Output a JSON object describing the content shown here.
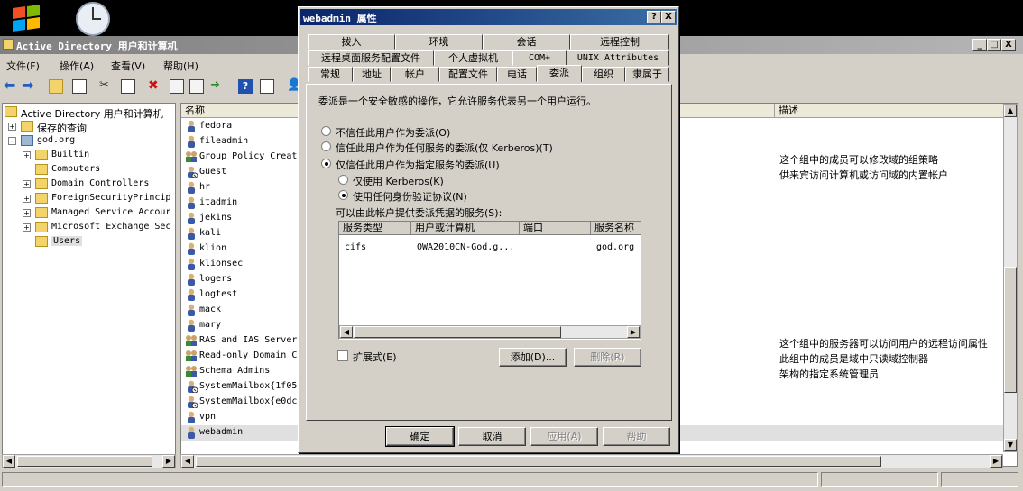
{
  "main_window": {
    "title": "Active Directory 用户和计算机",
    "menu": [
      "文件(F)",
      "操作(A)",
      "查看(V)",
      "帮助(H)"
    ]
  },
  "tree": {
    "items": [
      {
        "label": "Active Directory 用户和计算机",
        "level": 0,
        "expander": ""
      },
      {
        "label": "保存的查询",
        "level": 1,
        "expander": "+"
      },
      {
        "label": "god.org",
        "level": 1,
        "expander": "-"
      },
      {
        "label": "Builtin",
        "level": 2,
        "expander": "+"
      },
      {
        "label": "Computers",
        "level": 2,
        "expander": ""
      },
      {
        "label": "Domain Controllers",
        "level": 2,
        "expander": "+"
      },
      {
        "label": "ForeignSecurityPrincip",
        "level": 2,
        "expander": "+"
      },
      {
        "label": "Managed Service Accour",
        "level": 2,
        "expander": "+"
      },
      {
        "label": "Microsoft Exchange Sec",
        "level": 2,
        "expander": "+"
      },
      {
        "label": "Users",
        "level": 2,
        "expander": ""
      }
    ]
  },
  "list": {
    "columns": {
      "name": "名称",
      "description": "描述"
    },
    "rows": [
      {
        "name": "fedora",
        "icon": "user"
      },
      {
        "name": "fileadmin",
        "icon": "user"
      },
      {
        "name": "Group Policy Creat",
        "icon": "group",
        "desc": "这个组中的成员可以修改域的组策略"
      },
      {
        "name": "Guest",
        "icon": "user-disabled",
        "desc": "供来宾访问计算机或访问域的内置帐户"
      },
      {
        "name": "hr",
        "icon": "user"
      },
      {
        "name": "itadmin",
        "icon": "user"
      },
      {
        "name": "jekins",
        "icon": "user"
      },
      {
        "name": "kali",
        "icon": "user"
      },
      {
        "name": "klion",
        "icon": "user"
      },
      {
        "name": "klionsec",
        "icon": "user"
      },
      {
        "name": "logers",
        "icon": "user"
      },
      {
        "name": "logtest",
        "icon": "user"
      },
      {
        "name": "mack",
        "icon": "user"
      },
      {
        "name": "mary",
        "icon": "user"
      },
      {
        "name": "RAS and IAS Server",
        "icon": "group",
        "desc": "这个组中的服务器可以访问用户的远程访问属性"
      },
      {
        "name": "Read-only Domain C",
        "icon": "group",
        "desc": "此组中的成员是域中只读域控制器"
      },
      {
        "name": "Schema Admins",
        "icon": "group",
        "desc": "架构的指定系统管理员"
      },
      {
        "name": "SystemMailbox{1f05",
        "icon": "user-disabled"
      },
      {
        "name": "SystemMailbox{e0dc",
        "icon": "user-disabled"
      },
      {
        "name": "vpn",
        "icon": "user"
      },
      {
        "name": "webadmin",
        "icon": "user"
      }
    ]
  },
  "dialog": {
    "title": "webadmin 属性",
    "help_btn": "?",
    "close_btn": "X",
    "tabs_row1": [
      "拨入",
      "环境",
      "会话",
      "远程控制"
    ],
    "tabs_row2": [
      "远程桌面服务配置文件",
      "个人虚拟机",
      "COM+",
      "UNIX Attributes"
    ],
    "tabs_row3": [
      "常规",
      "地址",
      "帐户",
      "配置文件",
      "电话",
      "委派",
      "组织",
      "隶属于"
    ],
    "active_tab": "委派",
    "intro": "委派是一个安全敏感的操作，它允许服务代表另一个用户运行。",
    "options": {
      "no_trust": "不信任此用户作为委派(O)",
      "trust_any": "信任此用户作为任何服务的委派(仅 Kerberos)(T)",
      "trust_specified": "仅信任此用户作为指定服务的委派(U)",
      "kerberos_only": "仅使用 Kerberos(K)",
      "any_protocol": "使用任何身份验证协议(N)"
    },
    "selected_option": "trust_specified",
    "selected_protocol": "any_protocol",
    "services_label": "可以由此帐户提供委派凭据的服务(S):",
    "services_columns": [
      "服务类型",
      "用户或计算机",
      "端口",
      "服务名称"
    ],
    "services_rows": [
      {
        "type": "cifs",
        "host": "OWA2010CN-God.g...",
        "port": "",
        "service": "god.org"
      }
    ],
    "expanded_label": "扩展式(E)",
    "expanded_checked": false,
    "add_btn": "添加(D)...",
    "remove_btn": "删除(R)",
    "ok_btn": "确定",
    "cancel_btn": "取消",
    "apply_btn": "应用(A)",
    "help_btn2": "帮助"
  }
}
